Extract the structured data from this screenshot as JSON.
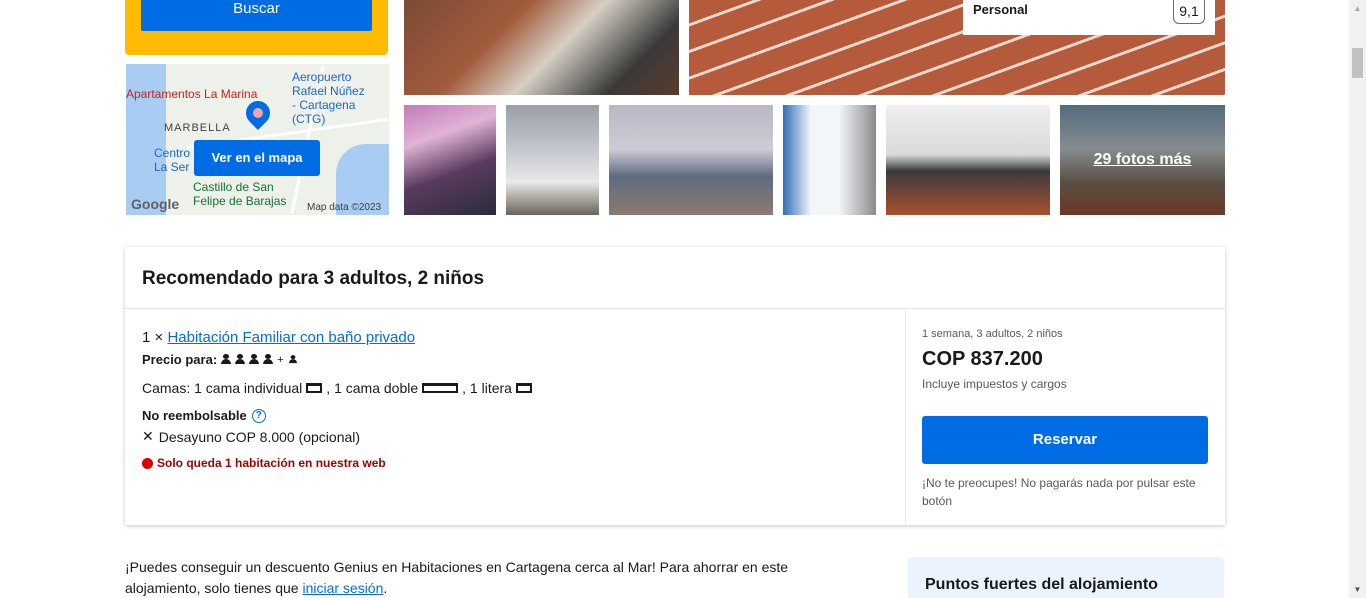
{
  "search": {
    "button_label": "Buscar"
  },
  "map": {
    "button_label": "Ver en el mapa",
    "labels": {
      "apartamentos": "Apartamentos La Marina",
      "aeropuerto_1": "Aeropuerto",
      "aeropuerto_2": "Rafael Núñez",
      "aeropuerto_3": "- Cartagena",
      "aeropuerto_4": "(CTG)",
      "marbella": "MARBELLA",
      "centro_1": "Centro",
      "centro_2": "La Ser",
      "castillo_1": "Castillo de San",
      "castillo_2": "Felipe de Barajas",
      "google": "Google",
      "map_data": "Map data ©2023"
    }
  },
  "gallery": {
    "more_photos_label": "29 fotos más"
  },
  "score": {
    "label": "Personal",
    "value": "9,1"
  },
  "recommendation": {
    "title": "Recomendado para 3 adultos, 2 niños",
    "room_qty": "1 ×",
    "room_name": "Habitación Familiar con baño privado",
    "price_for_label": "Precio para:",
    "price_for_plus": "+",
    "beds_prefix": "Camas: 1 cama individual",
    "beds_mid": ", 1 cama doble",
    "beds_end": ", 1 litera",
    "non_refundable": "No reembolsable",
    "breakfast": "Desayuno COP 8.000 (opcional)",
    "only_one_left": "Solo queda 1 habitación en nuestra web",
    "stay_info": "1 semana, 3 adultos, 2 niños",
    "price": "COP 837.200",
    "taxes": "Incluye impuestos y cargos",
    "reserve_label": "Reservar",
    "reassure": "¡No te preocupes! No pagarás nada por pulsar este botón"
  },
  "genius": {
    "text_before": "¡Puedes conseguir un descuento Genius en Habitaciones en Cartagena cerca al Mar! Para ahorrar en este alojamiento, solo tienes que ",
    "link": "iniciar sesión",
    "text_after": "."
  },
  "highlights": {
    "title": "Puntos fuertes del alojamiento"
  },
  "colors": {
    "brand_blue": "#006ce4",
    "search_yellow": "#febb02",
    "alert_red": "#e10000"
  }
}
